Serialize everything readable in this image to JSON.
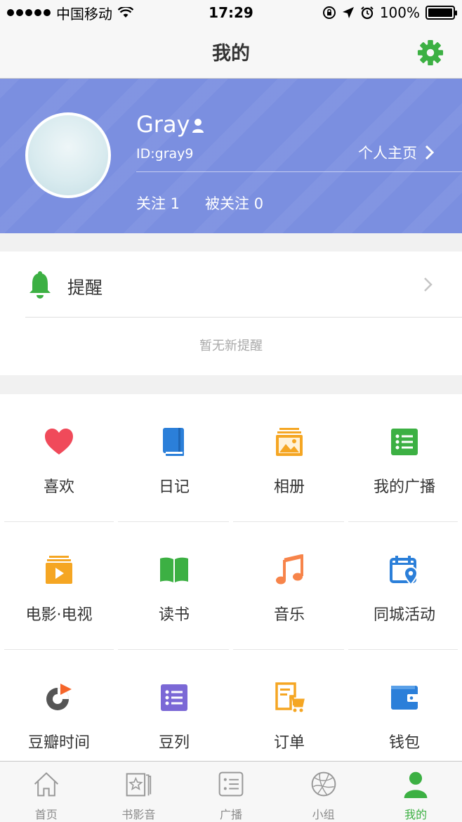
{
  "status_bar": {
    "carrier": "中国移动",
    "time": "17:29",
    "battery": "100%",
    "battery_level": 1.0
  },
  "header": {
    "title": "我的"
  },
  "profile": {
    "name": "Gray",
    "id_text": "ID:gray9",
    "homepage_label": "个人主页",
    "following_text": "关注 1",
    "followers_text": "被关注 0"
  },
  "reminder": {
    "title": "提醒",
    "empty_text": "暂无新提醒"
  },
  "grid": {
    "items": [
      {
        "label": "喜欢",
        "icon": "heart-icon"
      },
      {
        "label": "日记",
        "icon": "diary-icon"
      },
      {
        "label": "相册",
        "icon": "album-icon"
      },
      {
        "label": "我的广播",
        "icon": "broadcast-list-icon"
      },
      {
        "label": "电影·电视",
        "icon": "movie-tv-icon"
      },
      {
        "label": "读书",
        "icon": "book-icon"
      },
      {
        "label": "音乐",
        "icon": "music-note-icon"
      },
      {
        "label": "同城活动",
        "icon": "local-event-icon"
      },
      {
        "label": "豆瓣时间",
        "icon": "douban-time-icon"
      },
      {
        "label": "豆列",
        "icon": "doulist-icon"
      },
      {
        "label": "订单",
        "icon": "order-cart-icon"
      },
      {
        "label": "钱包",
        "icon": "wallet-icon"
      }
    ]
  },
  "tabbar": {
    "tabs": [
      {
        "label": "首页",
        "icon": "home-icon"
      },
      {
        "label": "书影音",
        "icon": "star-books-icon"
      },
      {
        "label": "广播",
        "icon": "broadcast-icon"
      },
      {
        "label": "小组",
        "icon": "group-icon"
      },
      {
        "label": "我的",
        "icon": "profile-icon",
        "active": true
      }
    ]
  },
  "colors": {
    "accent_green": "#3cb043",
    "profile_bg": "#7b8fe0",
    "heart_red": "#f04a5a",
    "blue": "#2b7fd9",
    "orange": "#f5a623",
    "purple": "#7b68d6"
  }
}
